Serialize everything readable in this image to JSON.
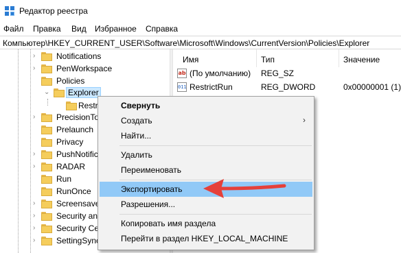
{
  "window": {
    "title": "Редактор реестра"
  },
  "menu": [
    "Файл",
    "Правка",
    "Вид",
    "Избранное",
    "Справка"
  ],
  "address": "Компьютер\\HKEY_CURRENT_USER\\Software\\Microsoft\\Windows\\CurrentVersion\\Policies\\Explorer",
  "tree": [
    {
      "label": "Notifications",
      "chevron": "›"
    },
    {
      "label": "PenWorkspace",
      "chevron": "›"
    },
    {
      "label": "Policies",
      "chevron": ""
    },
    {
      "label": "Explorer",
      "chevron": "⌄"
    },
    {
      "label": "Restri",
      "chevron": ""
    },
    {
      "label": "PrecisionTo",
      "chevron": "›"
    },
    {
      "label": "Prelaunch",
      "chevron": ""
    },
    {
      "label": "Privacy",
      "chevron": ""
    },
    {
      "label": "PushNotific",
      "chevron": "›"
    },
    {
      "label": "RADAR",
      "chevron": "›"
    },
    {
      "label": "Run",
      "chevron": ""
    },
    {
      "label": "RunOnce",
      "chevron": ""
    },
    {
      "label": "Screensave",
      "chevron": "›"
    },
    {
      "label": "Security an",
      "chevron": "›"
    },
    {
      "label": "Security Ce",
      "chevron": "›"
    },
    {
      "label": "SettingSync",
      "chevron": "›"
    }
  ],
  "list": {
    "columns": [
      "Имя",
      "Тип",
      "Значение"
    ],
    "rows": [
      {
        "icon": "ab",
        "name": "(По умолчанию)",
        "type": "REG_SZ",
        "value": ""
      },
      {
        "icon": "011",
        "name": "RestrictRun",
        "type": "REG_DWORD",
        "value": "0x00000001 (1)"
      }
    ]
  },
  "context_menu": [
    {
      "label": "Свернуть",
      "bold": true
    },
    {
      "label": "Создать",
      "submenu": "›"
    },
    {
      "label": "Найти..."
    },
    {
      "label": "Удалить"
    },
    {
      "label": "Переименовать"
    },
    {
      "label": "Экспортировать",
      "highlighted": true
    },
    {
      "label": "Разрешения..."
    },
    {
      "label": "Копировать имя раздела"
    },
    {
      "label": "Перейти в раздел HKEY_LOCAL_MACHINE"
    }
  ],
  "colors": {
    "highlight": "#91c9f7",
    "selection": "#cce8ff",
    "arrow": "#e5403a",
    "folder": "#f5cd5c"
  },
  "icons": {
    "app": "registry-icon",
    "folder": "folder-icon",
    "string_value": "string-value-icon",
    "dword_value": "dword-value-icon",
    "submenu": "chevron-right-icon",
    "annotation": "red-arrow-icon"
  }
}
